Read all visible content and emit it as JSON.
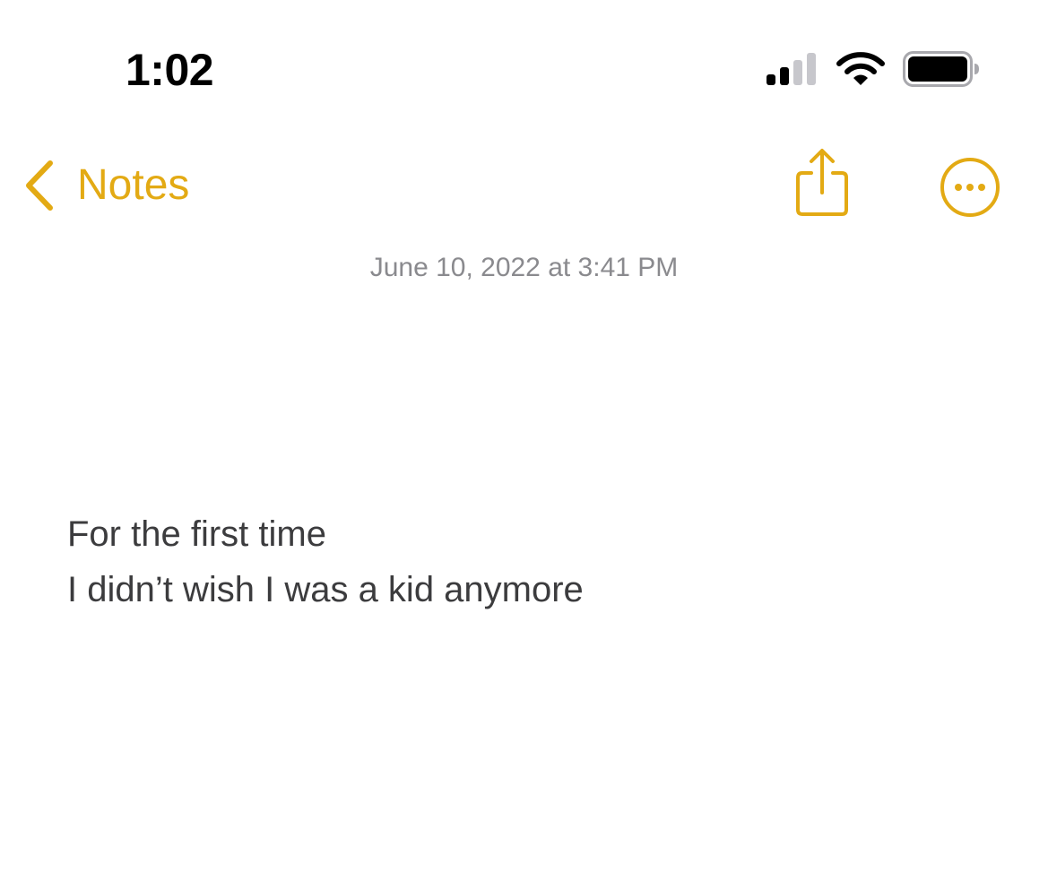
{
  "status_bar": {
    "time": "1:02",
    "signal_icon": "cellular-signal-icon",
    "wifi_icon": "wifi-icon",
    "battery_icon": "battery-icon"
  },
  "nav": {
    "back_label": "Notes",
    "back_icon": "chevron-left-icon",
    "share_icon": "share-icon",
    "more_icon": "ellipsis-circle-icon",
    "accent_color": "#E3AA14"
  },
  "note": {
    "date": "June 10, 2022 at 3:41 PM",
    "lines": [
      "For the first time",
      "I didn’t wish I was a kid anymore"
    ]
  }
}
